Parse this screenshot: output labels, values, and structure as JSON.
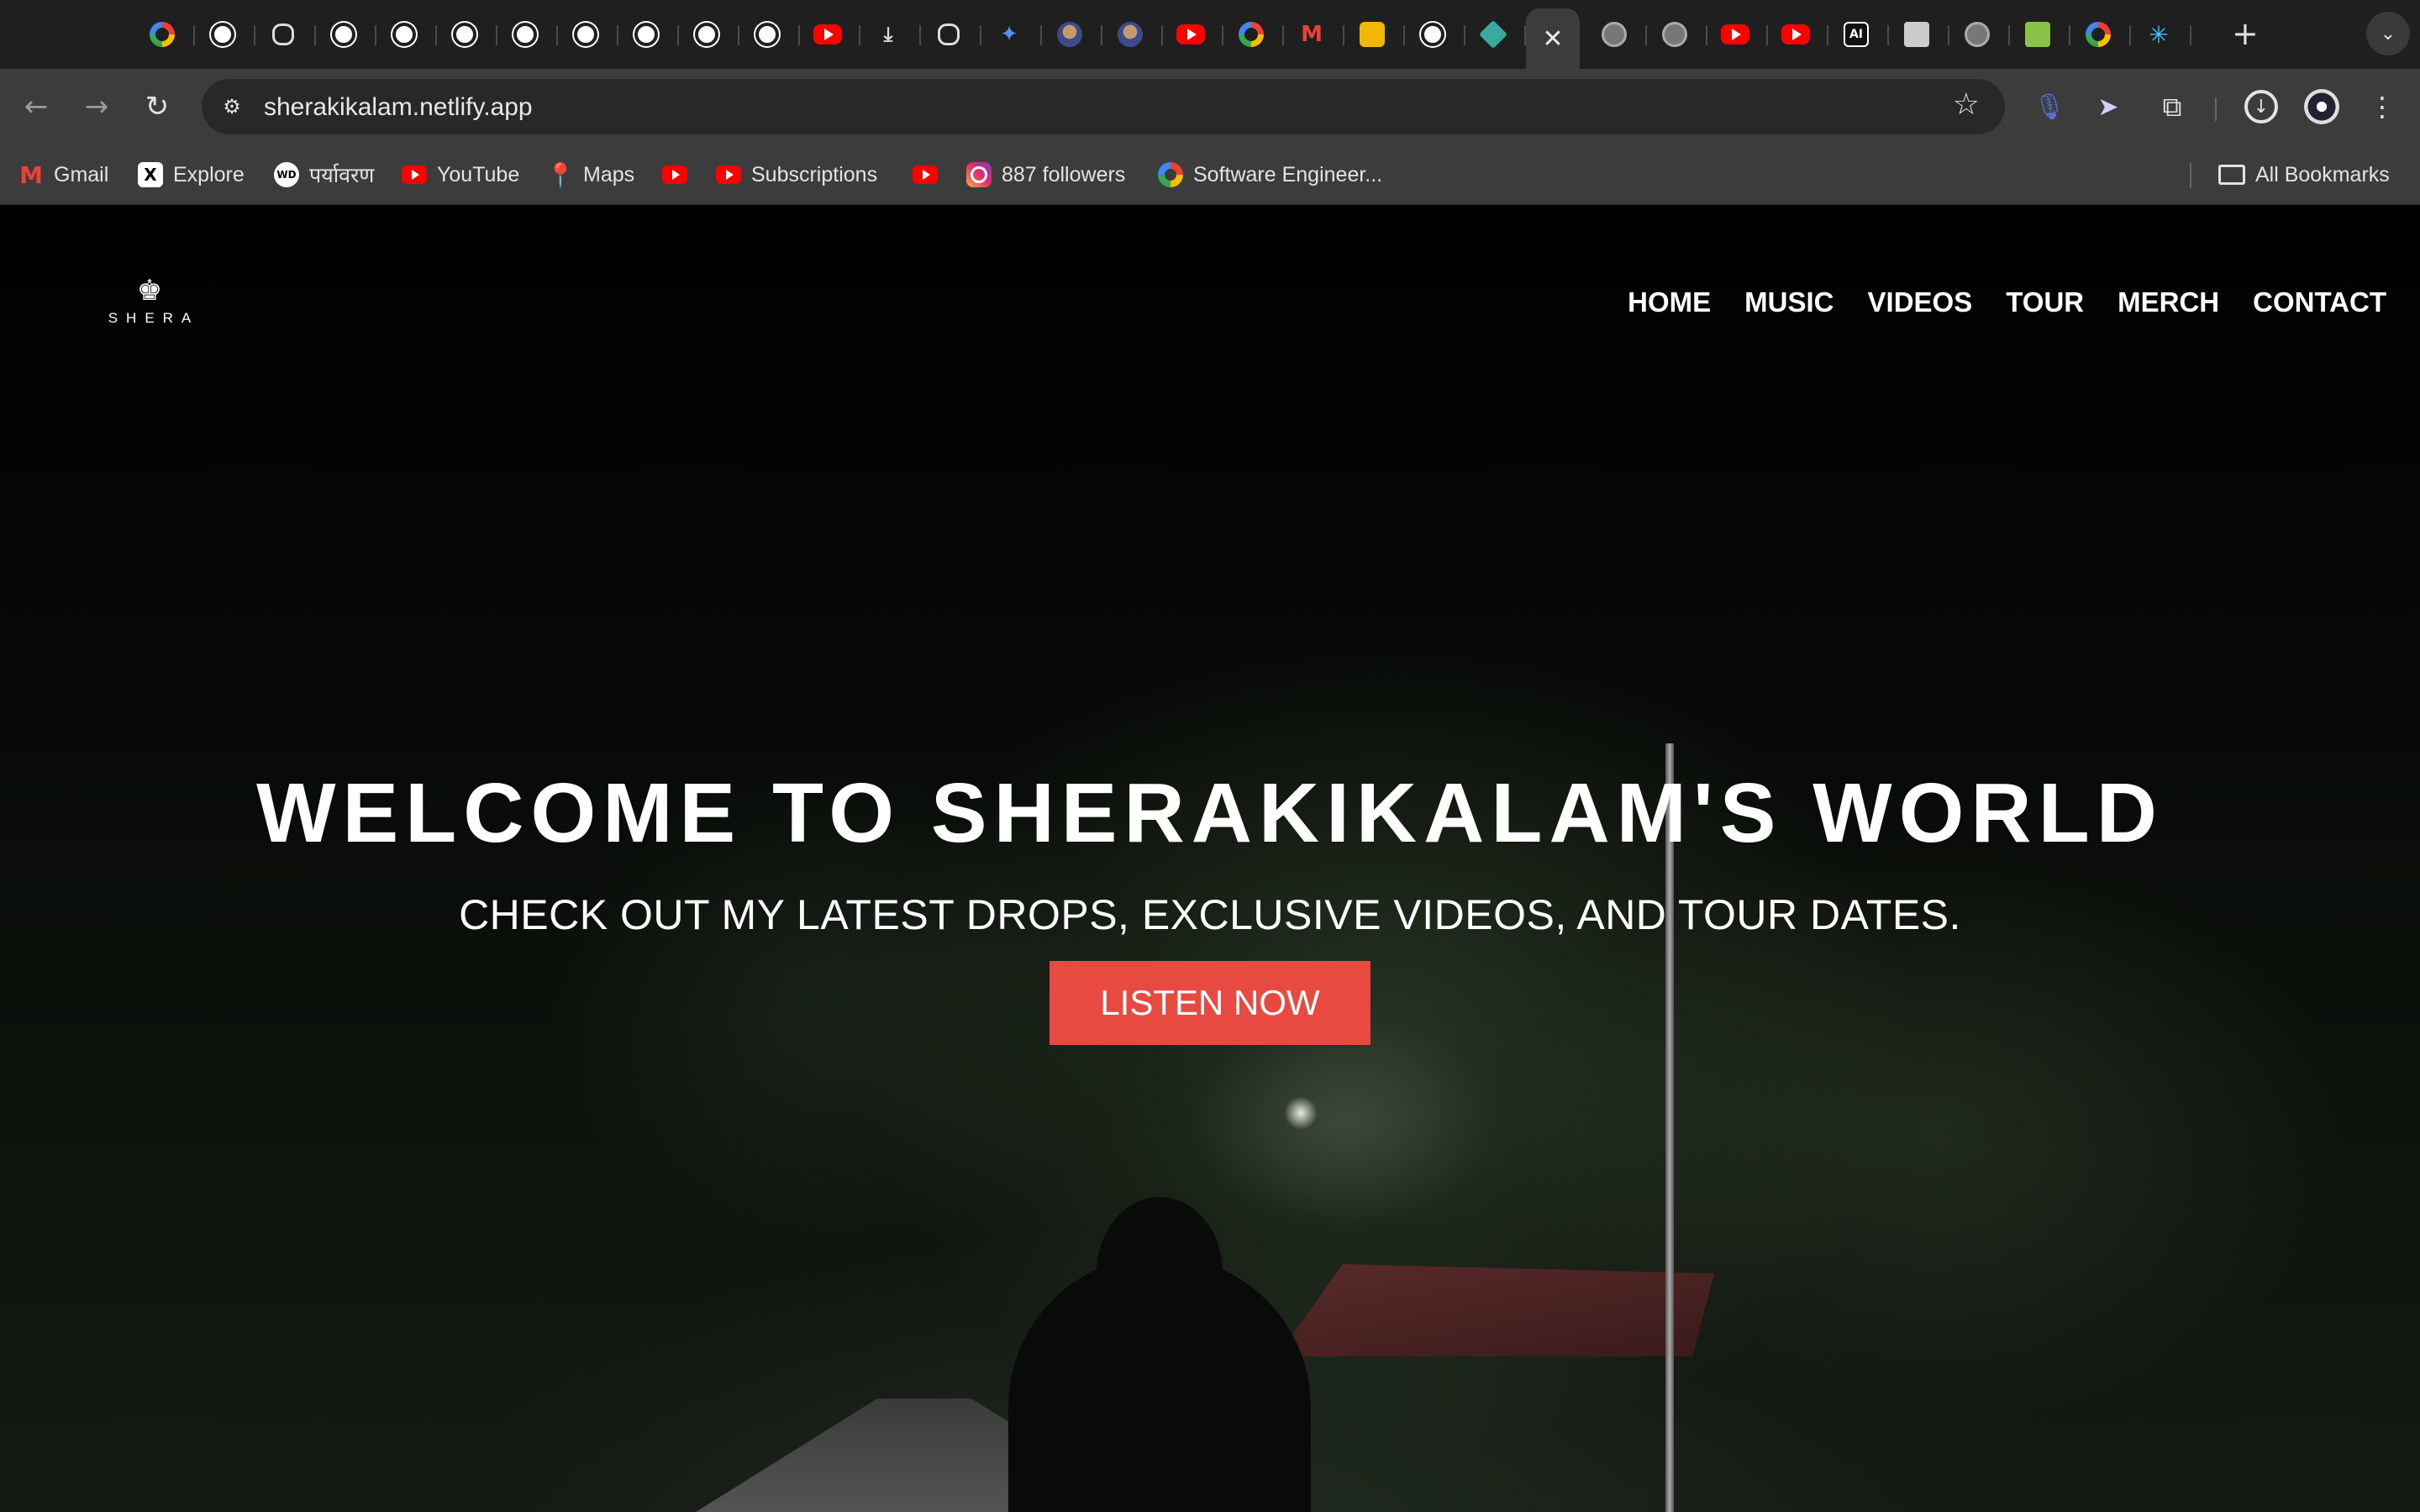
{
  "browser": {
    "tabs": [
      {
        "icon": "google-icon"
      },
      {
        "icon": "github-icon"
      },
      {
        "icon": "openai-icon"
      },
      {
        "icon": "github-icon"
      },
      {
        "icon": "github-icon"
      },
      {
        "icon": "github-icon"
      },
      {
        "icon": "github-icon"
      },
      {
        "icon": "github-icon"
      },
      {
        "icon": "github-icon"
      },
      {
        "icon": "github-icon"
      },
      {
        "icon": "github-icon"
      },
      {
        "icon": "youtube-icon"
      },
      {
        "icon": "download-icon"
      },
      {
        "icon": "openai-icon"
      },
      {
        "icon": "gemini-icon"
      },
      {
        "icon": "avatar-icon"
      },
      {
        "icon": "avatar-icon"
      },
      {
        "icon": "youtube-icon"
      },
      {
        "icon": "google-icon"
      },
      {
        "icon": "gmail-icon"
      },
      {
        "icon": "book-icon"
      },
      {
        "icon": "github-icon"
      },
      {
        "icon": "diamond-icon"
      },
      {
        "icon": "close-icon",
        "active": true
      },
      {
        "icon": "globe-icon"
      },
      {
        "icon": "globe-icon"
      },
      {
        "icon": "youtube-icon"
      },
      {
        "icon": "youtube-icon"
      },
      {
        "icon": "ai-icon"
      },
      {
        "icon": "image-icon"
      },
      {
        "icon": "globe-icon"
      },
      {
        "icon": "green-square-icon"
      },
      {
        "icon": "google-icon"
      },
      {
        "icon": "sparkle-icon"
      }
    ],
    "url": "sherakikalam.netlify.app",
    "bookmarks": [
      {
        "label": "Gmail",
        "icon": "gmail-icon"
      },
      {
        "label": "Explore",
        "icon": "x-icon"
      },
      {
        "label": "पर्यावरण",
        "icon": "wd-icon"
      },
      {
        "label": "YouTube",
        "icon": "youtube-icon"
      },
      {
        "label": "Maps",
        "icon": "maps-icon"
      },
      {
        "label": "",
        "icon": "youtube-icon"
      },
      {
        "label": "Subscriptions",
        "icon": "youtube-icon"
      },
      {
        "label": "",
        "icon": "youtube-icon"
      },
      {
        "label": "887 followers",
        "icon": "instagram-icon"
      },
      {
        "label": "Software Engineer...",
        "icon": "google-icon"
      }
    ],
    "all_bookmarks": "All Bookmarks"
  },
  "site": {
    "logo_text": "SHERA",
    "nav": [
      "HOME",
      "MUSIC",
      "VIDEOS",
      "TOUR",
      "MERCH",
      "CONTACT"
    ],
    "hero_title": "WELCOME TO SHERAKIKALAM'S WORLD",
    "hero_subtitle": "CHECK OUT MY LATEST DROPS, EXCLUSIVE VIDEOS, AND TOUR DATES.",
    "cta_label": "LISTEN NOW"
  },
  "colors": {
    "accent": "#e84a42",
    "chrome_dark": "#1f1f1f",
    "chrome_toolbar": "#3c3c3c"
  }
}
